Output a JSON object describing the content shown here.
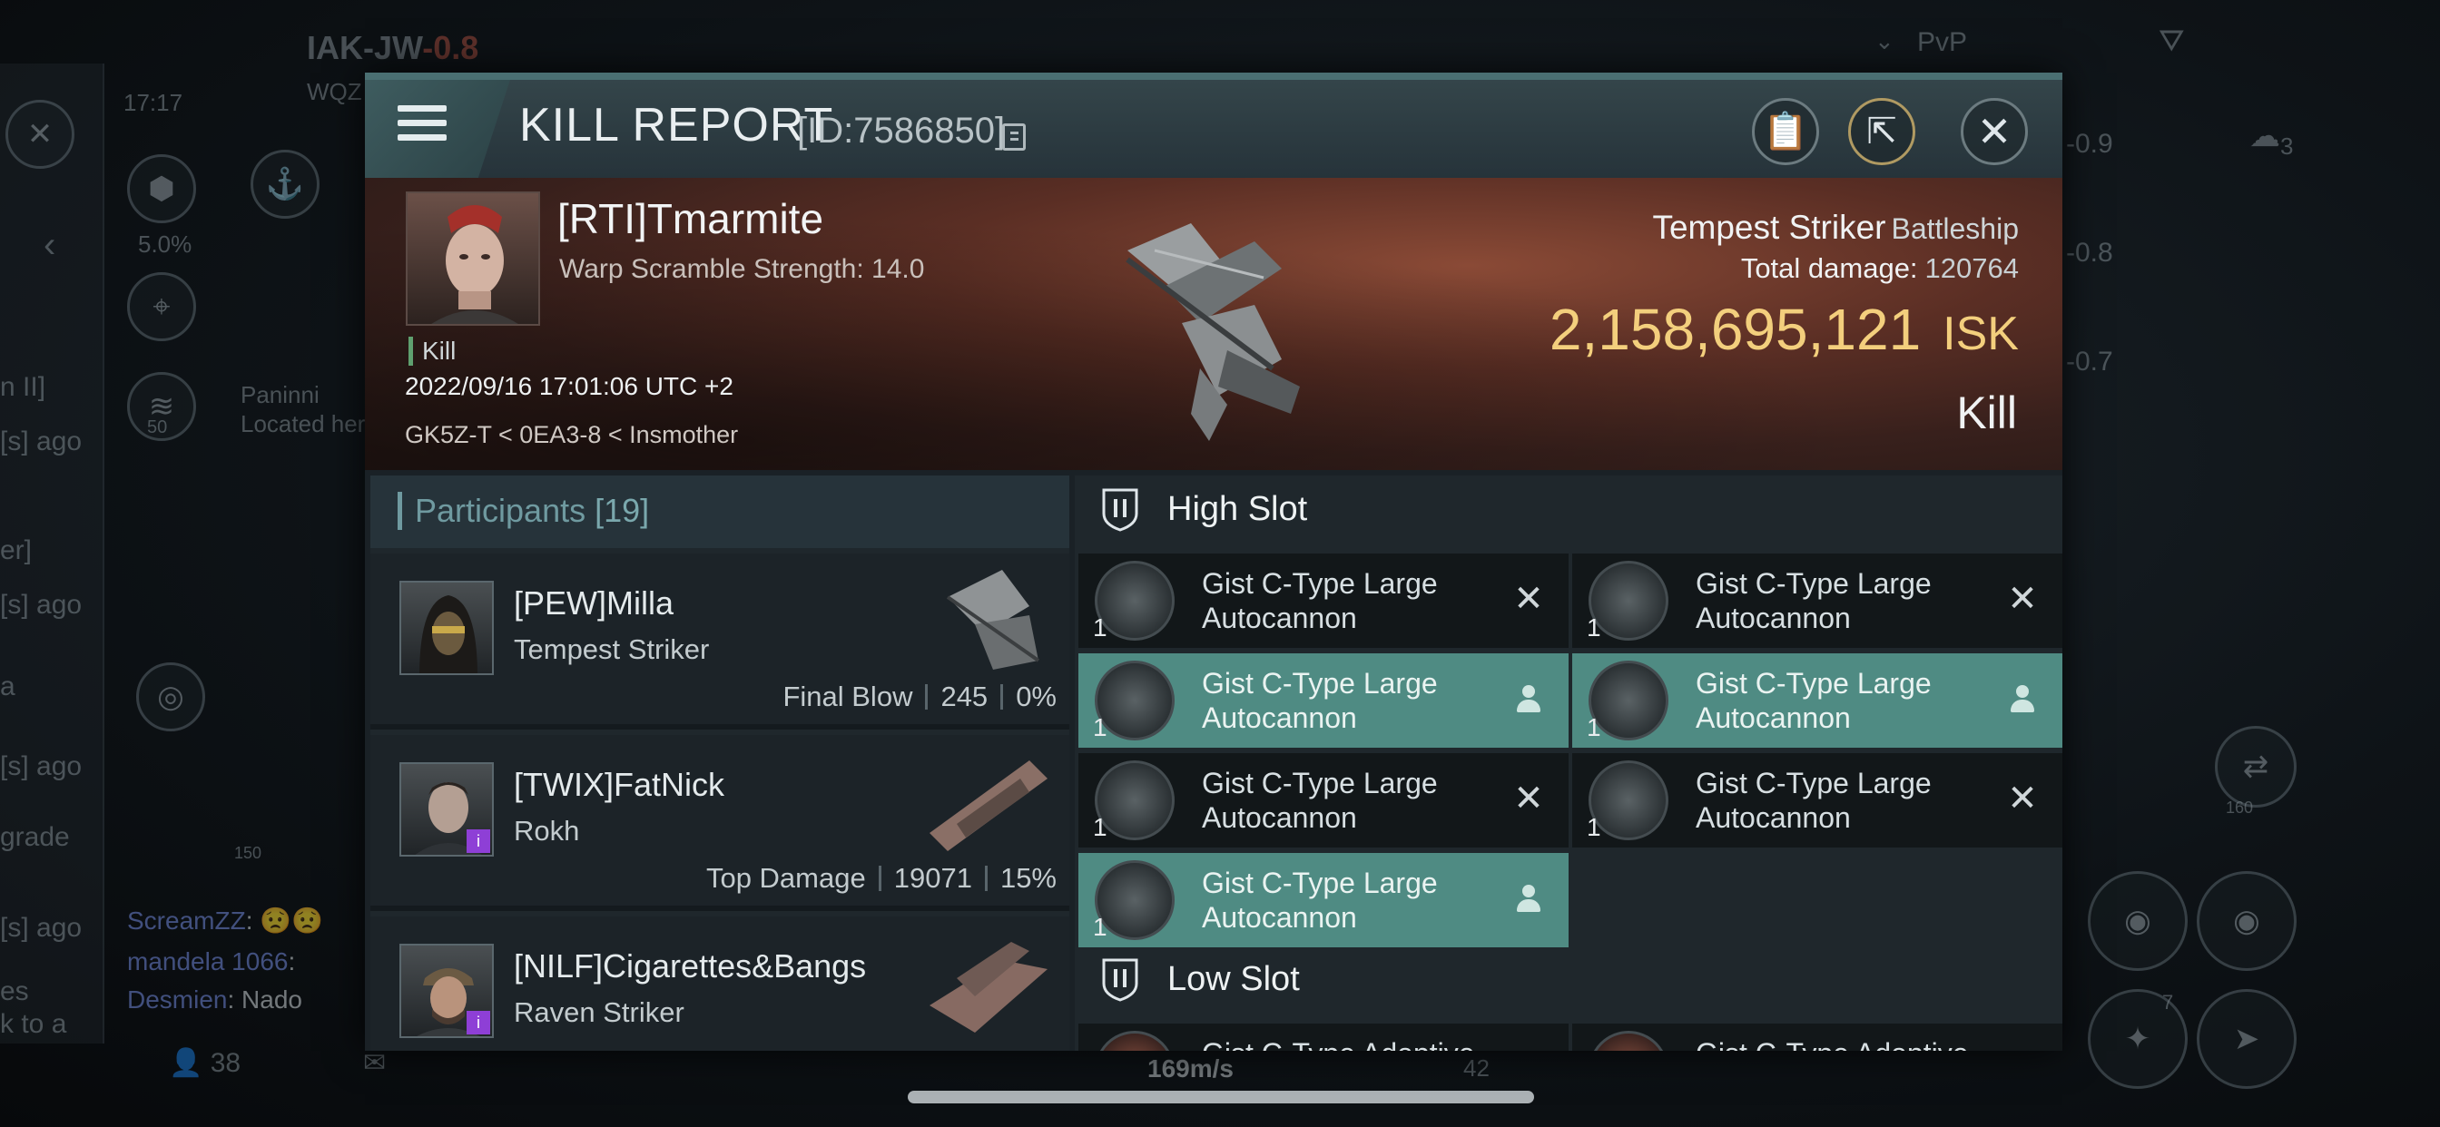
{
  "background": {
    "system_name": "IAK-JW",
    "system_security": "-0.8",
    "system_sub": "WQZ",
    "clock": "17:17",
    "cargo_percent": "5.0%",
    "fleet_count": "50",
    "chat_member": "Paninni",
    "chat_member_sub": "Located here",
    "filter_label": "PvP",
    "local_count": "3",
    "right_values": [
      "-0.9",
      "-0.8",
      "-0.7"
    ],
    "left_fragments": [
      "n II]",
      "[s] ago",
      "er]",
      "[s] ago",
      "a",
      "[s] ago",
      "grade",
      "[s] ago",
      "es",
      "k to a"
    ],
    "chat_lines": [
      {
        "name": "ScreamZZ",
        "text": ": 😟😟"
      },
      {
        "name": "mandela 1066",
        "text": ":"
      },
      {
        "name": "Desmien",
        "text": ": Nado"
      }
    ],
    "player_count": "38",
    "speed": "169m/s",
    "speed_right": "42",
    "map_label": "150",
    "drone_count": "7",
    "ring_label": "160"
  },
  "modal": {
    "title": "KILL REPORT",
    "report_id": "[ID:7586850]",
    "victim": {
      "name": "[RTI]Tmarmite",
      "warp_scramble": "Warp Scramble Strength: 14.0",
      "kill_tag": "Kill",
      "datetime": "2022/09/16 17:01:06 UTC +2",
      "location": "GK5Z-T < 0EA3-8 < Insmother"
    },
    "ship": {
      "name": "Tempest Striker",
      "class": "Battleship",
      "total_damage_label": "Total damage:",
      "total_damage": "120764",
      "isk_value": "2,158,695,121",
      "isk_unit": "ISK",
      "result": "Kill"
    },
    "participants": {
      "label": "Participants",
      "count": "[19]",
      "rows": [
        {
          "name": "[PEW]Milla",
          "ship": "Tempest Striker",
          "stat_label": "Final Blow",
          "damage": "245",
          "percent": "0%"
        },
        {
          "name": "[TWIX]FatNick",
          "ship": "Rokh",
          "stat_label": "Top Damage",
          "damage": "19071",
          "percent": "15%"
        },
        {
          "name": "[NILF]Cigarettes&Bangs",
          "ship": "Raven Striker",
          "stat_label": "",
          "damage": "",
          "percent": ""
        }
      ]
    },
    "high_slot": {
      "title": "High Slot",
      "items": [
        {
          "name": "Gist C-Type Large Autocannon",
          "qty": "1",
          "status": "destroyed"
        },
        {
          "name": "Gist C-Type Large Autocannon",
          "qty": "1",
          "status": "destroyed"
        },
        {
          "name": "Gist C-Type Large Autocannon",
          "qty": "1",
          "status": "dropped"
        },
        {
          "name": "Gist C-Type Large Autocannon",
          "qty": "1",
          "status": "dropped"
        },
        {
          "name": "Gist C-Type Large Autocannon",
          "qty": "1",
          "status": "destroyed"
        },
        {
          "name": "Gist C-Type Large Autocannon",
          "qty": "1",
          "status": "destroyed"
        },
        {
          "name": "Gist C-Type Large Autocannon",
          "qty": "1",
          "status": "dropped"
        }
      ]
    },
    "low_slot": {
      "title": "Low Slot",
      "items": [
        {
          "name": "Gist C-Type Adaptive",
          "qty": "1"
        },
        {
          "name": "Gist C-Type Adaptive",
          "qty": "1"
        }
      ]
    }
  }
}
